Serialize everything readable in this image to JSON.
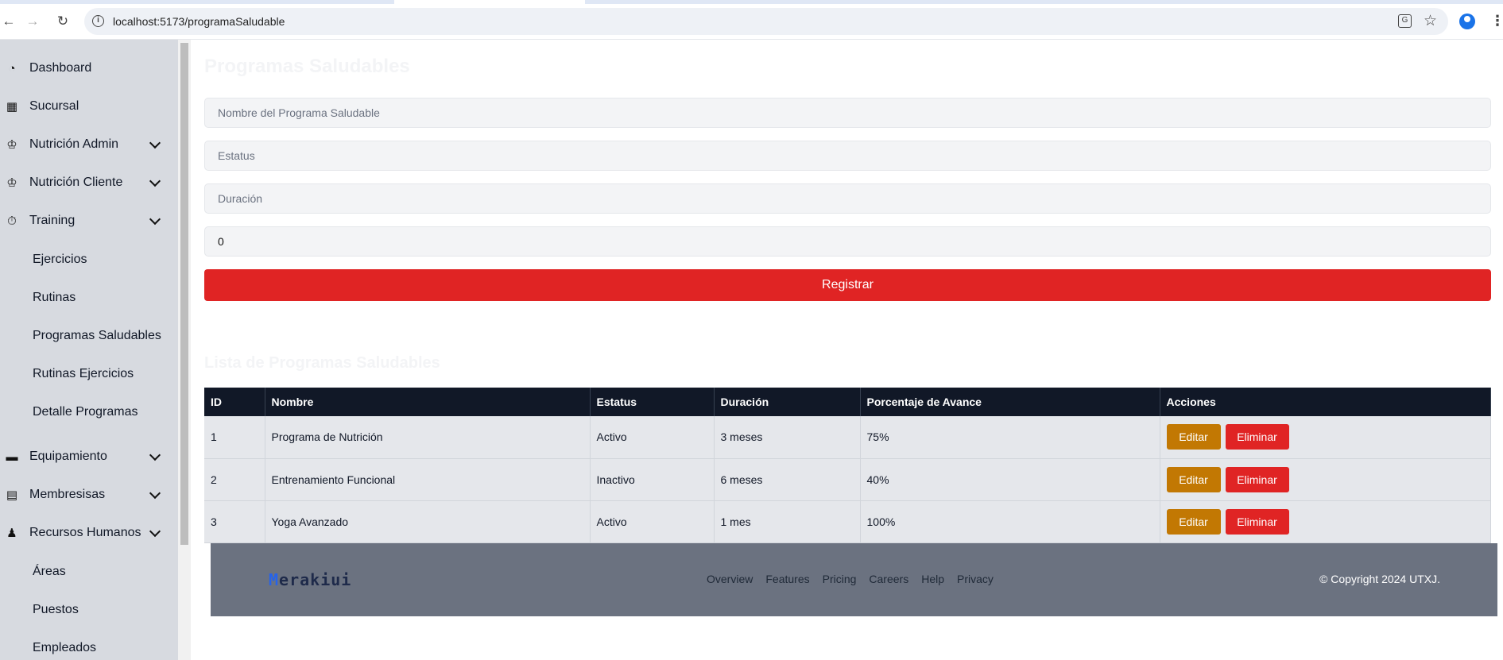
{
  "browser": {
    "url": "localhost:5173/programaSaludable"
  },
  "sidebar": {
    "items": [
      {
        "label": "Dashboard",
        "icon": "pie-chart-icon"
      },
      {
        "label": "Sucursal",
        "icon": "building-icon"
      },
      {
        "label": "Nutrición Admin",
        "icon": "nutrition-icon"
      },
      {
        "label": "Nutrición Cliente",
        "icon": "nutrition-icon"
      },
      {
        "label": "Training",
        "icon": "stopwatch-icon"
      }
    ],
    "training_sub": [
      "Ejercicios",
      "Rutinas",
      "Programas Saludables",
      "Rutinas Ejercicios",
      "Detalle Programas"
    ],
    "items2": [
      {
        "label": "Equipamiento",
        "icon": "dumbbell-icon"
      },
      {
        "label": "Membresisas",
        "icon": "id-card-icon"
      },
      {
        "label": "Recursos Humanos",
        "icon": "users-icon"
      }
    ],
    "rh_sub": [
      "Áreas",
      "Puestos",
      "Empleados"
    ]
  },
  "form": {
    "title": "Programas Saludables",
    "nombre_placeholder": "Nombre del Programa Saludable",
    "estatus_placeholder": "Estatus",
    "duracion_placeholder": "Duración",
    "avance_value": "0",
    "submit_label": "Registrar"
  },
  "list": {
    "title": "Lista de Programas Saludables",
    "headers": [
      "ID",
      "Nombre",
      "Estatus",
      "Duración",
      "Porcentaje de Avance",
      "Acciones"
    ],
    "rows": [
      {
        "id": "1",
        "nombre": "Programa de Nutrición",
        "estatus": "Activo",
        "duracion": "3 meses",
        "avance": "75%"
      },
      {
        "id": "2",
        "nombre": "Entrenamiento Funcional",
        "estatus": "Inactivo",
        "duracion": "6 meses",
        "avance": "40%"
      },
      {
        "id": "3",
        "nombre": "Yoga Avanzado",
        "estatus": "Activo",
        "duracion": "1 mes",
        "avance": "100%"
      }
    ],
    "edit_label": "Editar",
    "delete_label": "Eliminar"
  },
  "footer": {
    "logo_first": "M",
    "logo_rest": "erakiui",
    "links": [
      "Overview",
      "Features",
      "Pricing",
      "Careers",
      "Help",
      "Privacy"
    ],
    "copyright": "© Copyright 2024 UTXJ."
  },
  "colors": {
    "accent_red": "#e02424",
    "edit_orange": "#c27803",
    "header_dark": "#111827",
    "sidebar_bg": "#d7dae0",
    "footer_bg": "#6b7280"
  }
}
